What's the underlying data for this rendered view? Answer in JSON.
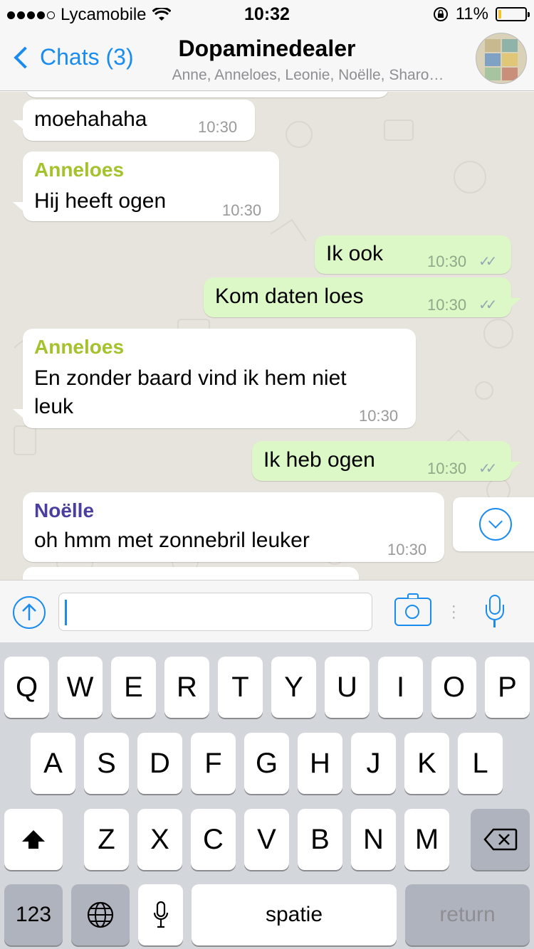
{
  "status_bar": {
    "carrier": "Lycamobile",
    "time": "10:32",
    "battery_percent": "11%",
    "battery_level": 0.11,
    "battery_color": "#f4c430",
    "signal_bars": 4
  },
  "nav": {
    "back_label": "Chats (3)",
    "title": "Dopaminedealer",
    "subtitle": "Anne, Anneloes, Leonie, Noëlle, Sharo…"
  },
  "messages": [
    {
      "direction": "in",
      "sender": "",
      "text": "moehahaha",
      "time": "10:30"
    },
    {
      "direction": "in",
      "sender": "Anneloes",
      "text": "Hij heeft ogen",
      "time": "10:30"
    },
    {
      "direction": "out",
      "text": "Ik ook",
      "time": "10:30",
      "ticks": "✓✓"
    },
    {
      "direction": "out",
      "text": "Kom daten loes",
      "time": "10:30",
      "ticks": "✓✓"
    },
    {
      "direction": "in",
      "sender": "Anneloes",
      "text_line1": "En zonder baard vind ik hem niet",
      "text_line2": "leuk",
      "time": "10:30"
    },
    {
      "direction": "out",
      "text": "Ik heb ogen",
      "time": "10:30",
      "ticks": "✓✓"
    },
    {
      "direction": "in",
      "sender": "Noëlle",
      "text": "oh hmm met zonnebril leuker",
      "time": "10:30"
    }
  ],
  "colors": {
    "accent": "#1a8cf0",
    "anneloes_name": "#a4c22b",
    "noelle_name": "#4a3f9e",
    "incoming_bubble": "#ffffff",
    "outgoing_bubble": "#dcf8c6"
  },
  "input": {
    "placeholder": "",
    "value": ""
  },
  "keyboard": {
    "row1": [
      "Q",
      "W",
      "E",
      "R",
      "T",
      "Y",
      "U",
      "I",
      "O",
      "P"
    ],
    "row2": [
      "A",
      "S",
      "D",
      "F",
      "G",
      "H",
      "J",
      "K",
      "L"
    ],
    "row3": [
      "Z",
      "X",
      "C",
      "V",
      "B",
      "N",
      "M"
    ],
    "numbers_label": "123",
    "space_label": "spatie",
    "return_label": "return",
    "shift_icon": "shift-icon",
    "backspace_icon": "backspace-icon",
    "globe_icon": "globe-icon",
    "dictation_icon": "microphone-icon"
  }
}
